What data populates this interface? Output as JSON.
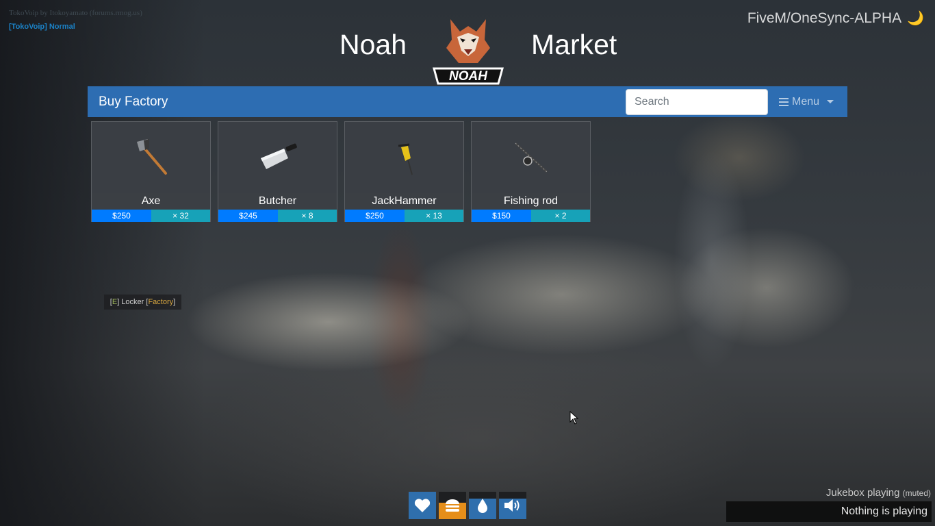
{
  "voip": {
    "credit": "TokoVoip by Itokoyamato (forums.rmog.us)",
    "mode": "[TokoVoip] Normal"
  },
  "server": {
    "name": "FiveM/OneSync-ALPHA",
    "icon": "moon-icon"
  },
  "header": {
    "title_left": "Noah",
    "title_right": "Market",
    "logo_text": "NOAH"
  },
  "navbar": {
    "title": "Buy Factory",
    "search_placeholder": "Search",
    "menu_label": "Menu"
  },
  "items": [
    {
      "name": "Axe",
      "price": "$250",
      "qty": "× 32",
      "icon": "axe-icon"
    },
    {
      "name": "Butcher",
      "price": "$245",
      "qty": "× 8",
      "icon": "cleaver-icon"
    },
    {
      "name": "JackHammer",
      "price": "$250",
      "qty": "× 13",
      "icon": "jackhammer-icon"
    },
    {
      "name": "Fishing rod",
      "price": "$150",
      "qty": "× 2",
      "icon": "fishing-rod-icon"
    }
  ],
  "locker": {
    "open": "[",
    "key": "E",
    "mid": "] Locker [",
    "name": "Factory",
    "close": "]"
  },
  "status": [
    {
      "name": "health",
      "icon": "heart-icon",
      "color": "#2f6fad",
      "level": 1.0
    },
    {
      "name": "hunger",
      "icon": "burger-icon",
      "color": "#e58e1a",
      "level": 0.6
    },
    {
      "name": "thirst",
      "icon": "water-drop-icon",
      "color": "#2f6fad",
      "level": 0.75
    },
    {
      "name": "voice",
      "icon": "speaker-icon",
      "color": "#2f6fad",
      "level": 0.75
    }
  ],
  "jukebox": {
    "label": "Jukebox playing",
    "muted": "(muted)",
    "status": "Nothing is playing"
  },
  "colors": {
    "navbar": "#2d6db2",
    "price_badge": "#007bff",
    "qty_badge": "#17a2b8"
  }
}
